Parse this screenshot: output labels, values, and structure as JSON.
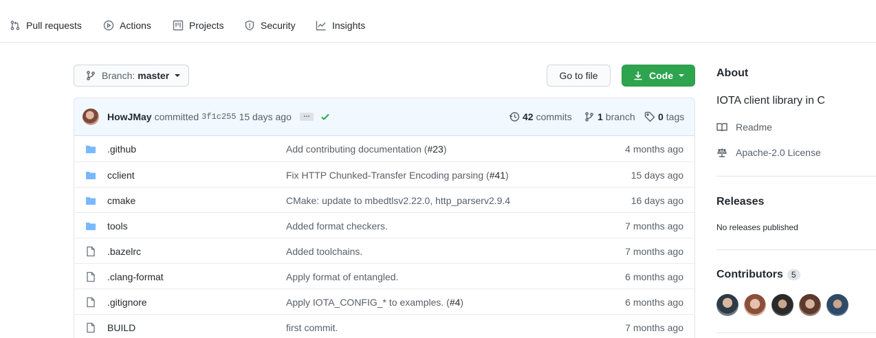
{
  "nav": {
    "items": [
      {
        "label": "Pull requests",
        "icon": "pull-request-icon"
      },
      {
        "label": "Actions",
        "icon": "play-icon"
      },
      {
        "label": "Projects",
        "icon": "project-icon"
      },
      {
        "label": "Security",
        "icon": "shield-icon"
      },
      {
        "label": "Insights",
        "icon": "graph-icon"
      }
    ]
  },
  "toolbar": {
    "branch_label": "Branch:",
    "branch_value": "master",
    "goto_file": "Go to file",
    "code": "Code"
  },
  "commit": {
    "author": "HowJMay",
    "action": "committed",
    "sha": "3f1c255",
    "age": "15 days ago",
    "ellipsis": "…",
    "commits_count": "42",
    "commits_label": "commits",
    "branch_count": "1",
    "branch_label": "branch",
    "tags_count": "0",
    "tags_label": "tags"
  },
  "files": [
    {
      "type": "folder",
      "name": ".github",
      "msg": "Add contributing documentation (",
      "pr": "#23",
      "msg_end": ")",
      "age": "4 months ago"
    },
    {
      "type": "folder",
      "name": "cclient",
      "msg": "Fix HTTP Chunked-Transfer Encoding parsing (",
      "pr": "#41",
      "msg_end": ")",
      "age": "15 days ago"
    },
    {
      "type": "folder",
      "name": "cmake",
      "msg": "CMake: update to mbedtlsv2.22.0, http_parserv2.9.4",
      "pr": "",
      "msg_end": "",
      "age": "16 days ago"
    },
    {
      "type": "folder",
      "name": "tools",
      "msg": "Added format checkers.",
      "pr": "",
      "msg_end": "",
      "age": "7 months ago"
    },
    {
      "type": "file",
      "name": ".bazelrc",
      "msg": "Added toolchains.",
      "pr": "",
      "msg_end": "",
      "age": "7 months ago"
    },
    {
      "type": "file",
      "name": ".clang-format",
      "msg": "Apply format of entangled.",
      "pr": "",
      "msg_end": "",
      "age": "6 months ago"
    },
    {
      "type": "file",
      "name": ".gitignore",
      "msg": "Apply IOTA_CONFIG_* to examples. (",
      "pr": "#4",
      "msg_end": ")",
      "age": "6 months ago"
    },
    {
      "type": "file",
      "name": "BUILD",
      "msg": "first commit.",
      "pr": "",
      "msg_end": "",
      "age": "7 months ago"
    }
  ],
  "sidebar": {
    "about_title": "About",
    "description": "IOTA client library in C",
    "readme": "Readme",
    "license": "Apache-2.0 License",
    "releases_title": "Releases",
    "no_releases": "No releases published",
    "contributors_title": "Contributors",
    "contributors_count": "5"
  },
  "colors": {
    "accent_green": "#2ea44f",
    "folder_blue": "#79b8ff",
    "check_green": "#28a745"
  }
}
